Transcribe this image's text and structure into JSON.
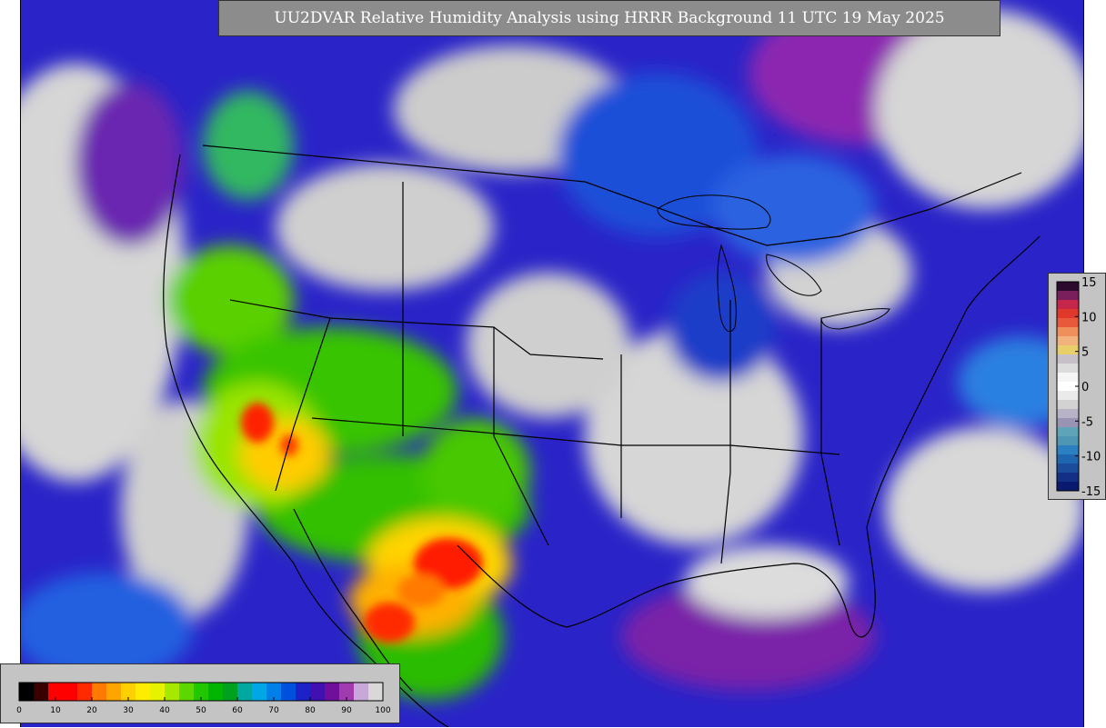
{
  "title": "UU2DVAR Relative Humidity Analysis using HRRR Background 11 UTC 19 May 2025",
  "increment_colorbar": {
    "ticks": [
      "15",
      "10",
      "5",
      "0",
      "-5",
      "-10",
      "-15"
    ],
    "colors": [
      "#2b0a2e",
      "#7a1f5c",
      "#c6264a",
      "#e0382a",
      "#e8583a",
      "#ef8f5c",
      "#f2b27e",
      "#e9cf69",
      "#c7c0c8",
      "#dcdcdc",
      "#f5f5f5",
      "#ffffff",
      "#eaeaea",
      "#d2d2d2",
      "#b8b2c6",
      "#9a94b4",
      "#5fa3b8",
      "#4f96b4",
      "#2c7fc0",
      "#1f66b0",
      "#1b4c9c",
      "#142f86",
      "#0a1a6e"
    ]
  },
  "rh_colorbar": {
    "ticks": [
      "0",
      "10",
      "20",
      "30",
      "40",
      "50",
      "60",
      "70",
      "80",
      "90",
      "100"
    ],
    "colors": [
      "#000000",
      "#3a0000",
      "#ff0000",
      "#ff0000",
      "#ff2a00",
      "#ff7a00",
      "#ffa500",
      "#ffd000",
      "#ffee00",
      "#e6f200",
      "#a6e800",
      "#5cd800",
      "#20c800",
      "#00b400",
      "#00a020",
      "#00a8a0",
      "#00a6e6",
      "#0080e8",
      "#0050e0",
      "#1a22c8",
      "#4010b0",
      "#70109a",
      "#a03cb0",
      "#c8a8d8",
      "#d8d8d8"
    ]
  }
}
